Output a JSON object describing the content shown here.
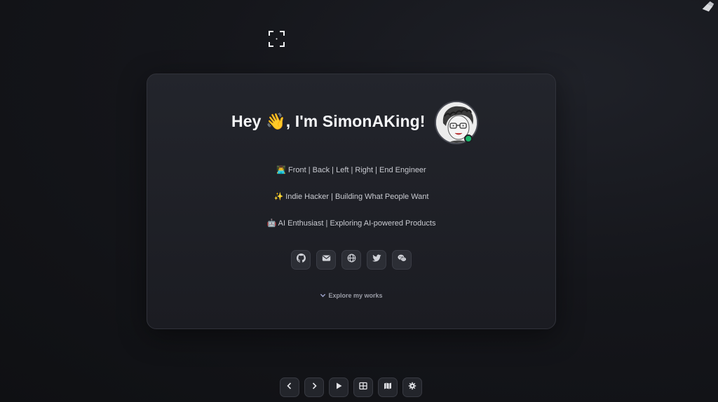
{
  "header": {
    "title": "Hey 👋, I'm SimonAKing!",
    "avatar_alt": "avatar",
    "status": "online"
  },
  "taglines": [
    "👨‍💻 Front | Back | Left | Right | End Engineer",
    "✨ Indie Hacker | Building What People Want",
    "🤖 AI Enthusiast | Exploring AI-powered Products"
  ],
  "socials": [
    {
      "name": "github",
      "icon": "github-icon"
    },
    {
      "name": "email",
      "icon": "mail-icon"
    },
    {
      "name": "website",
      "icon": "globe-icon"
    },
    {
      "name": "twitter",
      "icon": "twitter-icon"
    },
    {
      "name": "wechat",
      "icon": "wechat-icon"
    }
  ],
  "explore": {
    "label": "Explore my works",
    "icon": "chevron-down-icon"
  },
  "controls": [
    {
      "name": "previous",
      "icon": "chevron-left-icon"
    },
    {
      "name": "next",
      "icon": "chevron-right-icon"
    },
    {
      "name": "play",
      "icon": "play-icon"
    },
    {
      "name": "overview",
      "icon": "grid-icon"
    },
    {
      "name": "map",
      "icon": "map-icon"
    },
    {
      "name": "settings",
      "icon": "gear-icon"
    }
  ],
  "colors": {
    "background": "#15161b",
    "card": "#1f2127",
    "status": "#19b86b",
    "text": "#f5f6f8"
  }
}
